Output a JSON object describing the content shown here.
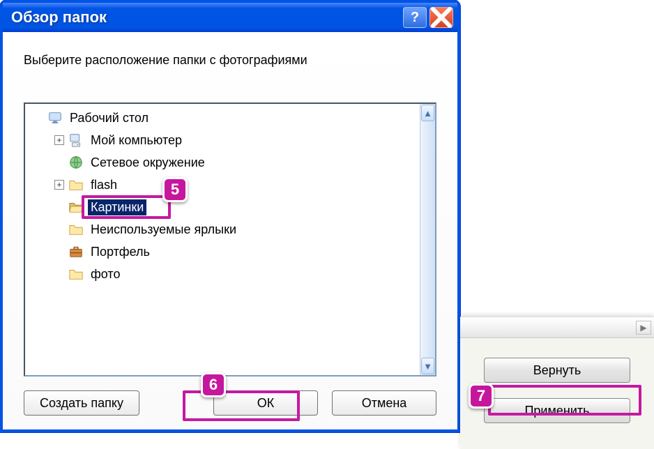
{
  "dialog": {
    "title": "Обзор папок",
    "instruction": "Выберите расположение папки с фотографиями",
    "tree": [
      {
        "indent": 0,
        "expander": "none",
        "icon": "desktop",
        "label": "Рабочий стол",
        "selected": false
      },
      {
        "indent": 1,
        "expander": "plus",
        "icon": "computer",
        "label": "Мой компьютер",
        "selected": false
      },
      {
        "indent": 1,
        "expander": "none",
        "icon": "network",
        "label": "Сетевое окружение",
        "selected": false
      },
      {
        "indent": 1,
        "expander": "plus",
        "icon": "folder",
        "label": "flash",
        "selected": false
      },
      {
        "indent": 1,
        "expander": "none",
        "icon": "folder-open",
        "label": "Картинки",
        "selected": true
      },
      {
        "indent": 1,
        "expander": "none",
        "icon": "folder",
        "label": "Неиспользуемые ярлыки",
        "selected": false
      },
      {
        "indent": 1,
        "expander": "none",
        "icon": "briefcase",
        "label": "Портфель",
        "selected": false
      },
      {
        "indent": 1,
        "expander": "none",
        "icon": "folder",
        "label": "фото",
        "selected": false
      }
    ],
    "buttons": {
      "create_folder": "Создать папку",
      "ok": "ОК",
      "cancel": "Отмена"
    }
  },
  "side": {
    "buttons": {
      "revert": "Вернуть",
      "apply": "Применить"
    }
  },
  "annotations": {
    "a5": "5",
    "a6": "6",
    "a7": "7"
  }
}
